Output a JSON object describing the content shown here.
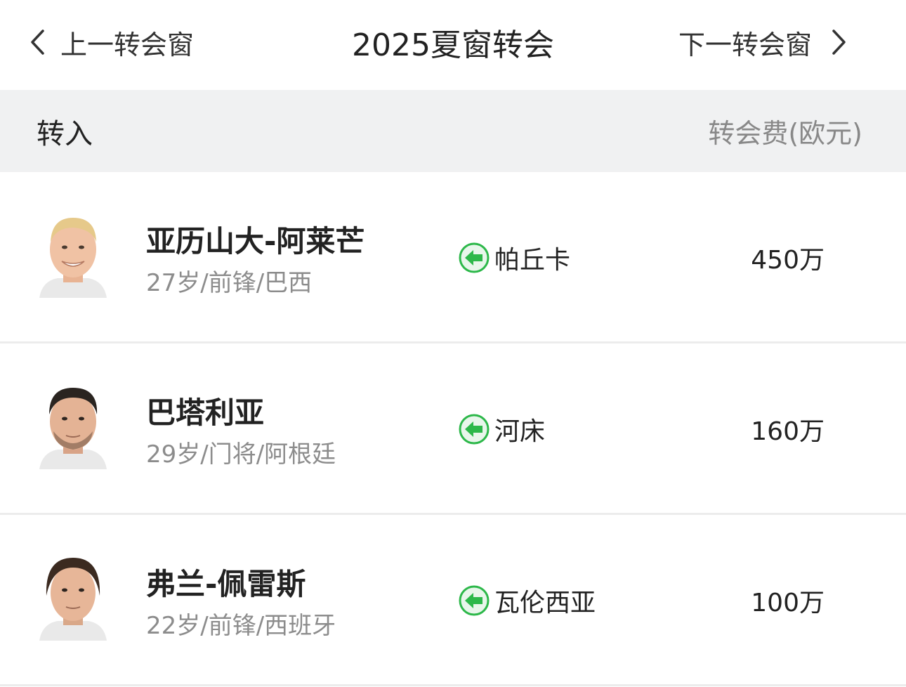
{
  "header": {
    "prev_label": "上一转会窗",
    "title": "2025夏窗转会",
    "next_label": "下一转会窗",
    "prev_icon": "chevron-left-icon",
    "next_icon": "chevron-right-icon"
  },
  "section": {
    "title": "转入",
    "fee_header": "转会费(欧元)"
  },
  "colors": {
    "section_bg": "#f0f1f2",
    "arrow_green": "#2db84a",
    "meta_gray": "#8c8c8c"
  },
  "transfers": [
    {
      "name": "亚历山大-阿莱芒",
      "info": "27岁/前锋/巴西",
      "from_club": "帕丘卡",
      "fee": "450万",
      "direction_icon": "arrow-in-icon"
    },
    {
      "name": "巴塔利亚",
      "info": "29岁/门将/阿根廷",
      "from_club": "河床",
      "fee": "160万",
      "direction_icon": "arrow-in-icon"
    },
    {
      "name": "弗兰-佩雷斯",
      "info": "22岁/前锋/西班牙",
      "from_club": "瓦伦西亚",
      "fee": "100万",
      "direction_icon": "arrow-in-icon"
    }
  ]
}
